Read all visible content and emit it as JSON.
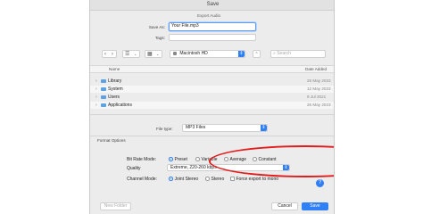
{
  "window": {
    "title": "Save",
    "subtitle": "Export Audio"
  },
  "save_as": {
    "label": "Save As:",
    "value": "Your File.mp3"
  },
  "tags": {
    "label": "Tags:"
  },
  "toolbar": {
    "back_icon": "chevron-left-icon",
    "forward_icon": "chevron-right-icon",
    "view_icon": "column-view-icon",
    "grid_icon": "grid-view-icon",
    "location": "Macintosh HD",
    "search_placeholder": "Search"
  },
  "list": {
    "col_name": "Name",
    "col_date": "Date Added",
    "rows": [
      {
        "name": "Library",
        "date": "26 May 2023"
      },
      {
        "name": "System",
        "date": "12 May 2023"
      },
      {
        "name": "Users",
        "date": "9 Jul 2021"
      },
      {
        "name": "Applications",
        "date": "26 May 2023"
      }
    ]
  },
  "file_type": {
    "label": "File type:",
    "value": "MP3 Files"
  },
  "format_options": {
    "heading": "Format Options",
    "bit_rate_label": "Bit Rate Mode:",
    "bit_rate_options": [
      "Preset",
      "Variable",
      "Average",
      "Constant"
    ],
    "bit_rate_selected": "Preset",
    "quality_label": "Quality",
    "quality_value": "Extreme, 220-260 kbps",
    "channel_label": "Channel Mode:",
    "channel_options": [
      "Joint Stereo",
      "Stereo"
    ],
    "channel_selected": "Joint Stereo",
    "force_mono_label": "Force export to mono"
  },
  "help_label": "?",
  "buttons": {
    "new_folder": "New Folder",
    "cancel": "Cancel",
    "save": "Save"
  },
  "colors": {
    "accent": "#2f7ff5",
    "highlight_oval": "#e31b1b"
  }
}
